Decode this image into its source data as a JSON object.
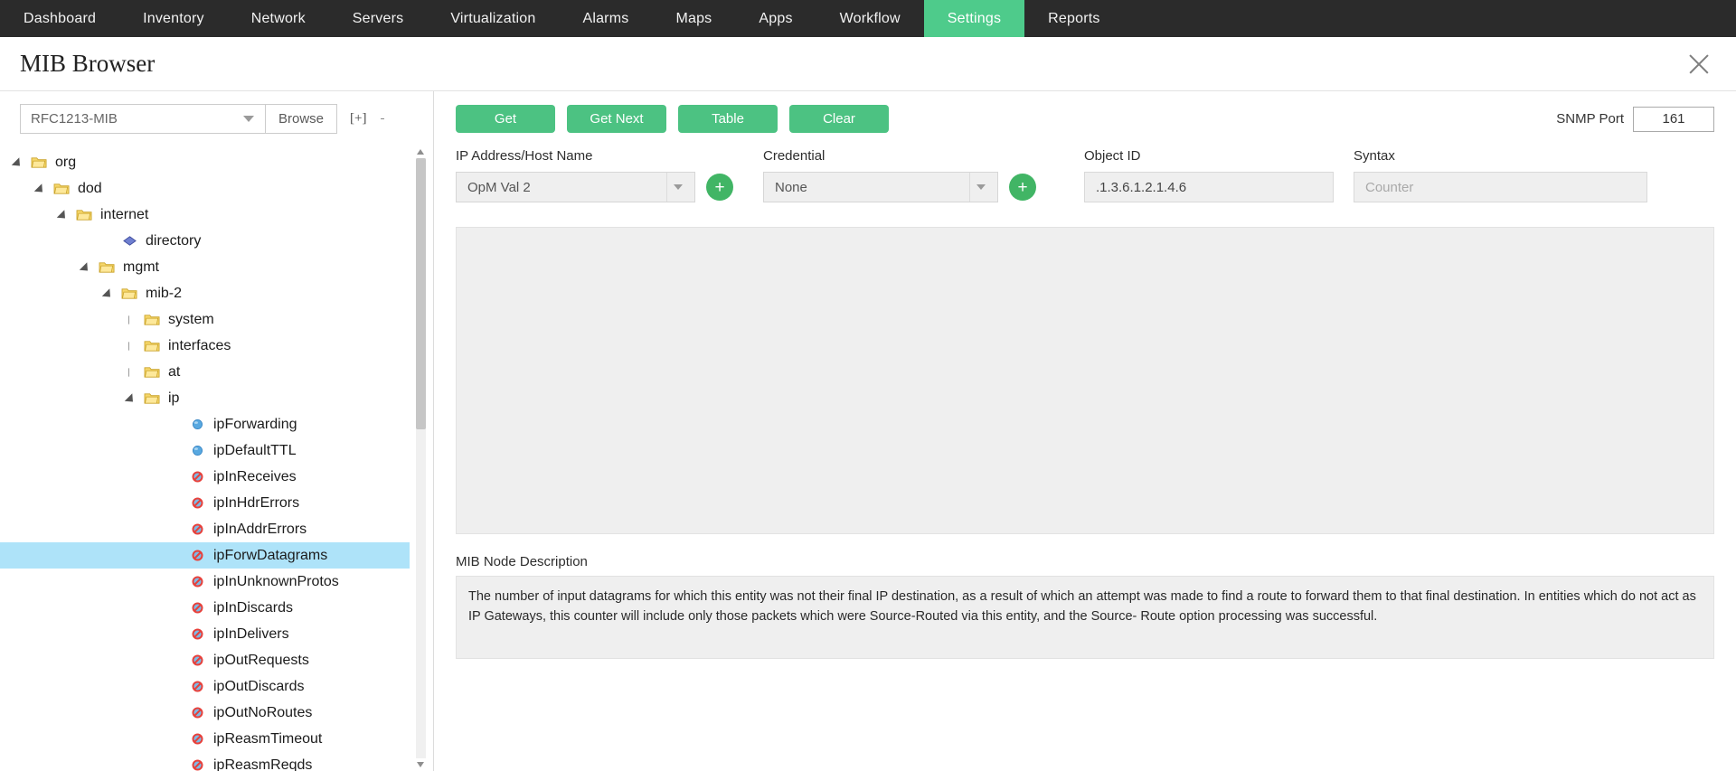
{
  "nav": {
    "items": [
      {
        "label": "Dashboard",
        "active": false
      },
      {
        "label": "Inventory",
        "active": false
      },
      {
        "label": "Network",
        "active": false
      },
      {
        "label": "Servers",
        "active": false
      },
      {
        "label": "Virtualization",
        "active": false
      },
      {
        "label": "Alarms",
        "active": false
      },
      {
        "label": "Maps",
        "active": false
      },
      {
        "label": "Apps",
        "active": false
      },
      {
        "label": "Workflow",
        "active": false
      },
      {
        "label": "Settings",
        "active": true
      },
      {
        "label": "Reports",
        "active": false
      }
    ],
    "active_color": "#4ecb8b",
    "bg_color": "#2b2b2b"
  },
  "header": {
    "title": "MIB Browser",
    "close_icon": "close-icon"
  },
  "mib_selector": {
    "selected": "RFC1213-MIB",
    "browse_label": "Browse",
    "expand_all_label": "[+]",
    "collapse_all_label": "-"
  },
  "tree": {
    "nodes": [
      {
        "label": "org",
        "depth": 0,
        "icon": "folder-icon",
        "expander": "open",
        "selected": false
      },
      {
        "label": "dod",
        "depth": 1,
        "icon": "folder-icon",
        "expander": "open",
        "selected": false
      },
      {
        "label": "internet",
        "depth": 2,
        "icon": "folder-icon",
        "expander": "open",
        "selected": false
      },
      {
        "label": "directory",
        "depth": 4,
        "icon": "diamond-icon",
        "expander": "none",
        "selected": false
      },
      {
        "label": "mgmt",
        "depth": 3,
        "icon": "folder-icon",
        "expander": "open",
        "selected": false
      },
      {
        "label": "mib-2",
        "depth": 4,
        "icon": "folder-icon",
        "expander": "open",
        "selected": false
      },
      {
        "label": "system",
        "depth": 5,
        "icon": "folder-icon",
        "expander": "closed",
        "selected": false
      },
      {
        "label": "interfaces",
        "depth": 5,
        "icon": "folder-icon",
        "expander": "closed",
        "selected": false
      },
      {
        "label": "at",
        "depth": 5,
        "icon": "folder-icon",
        "expander": "closed",
        "selected": false
      },
      {
        "label": "ip",
        "depth": 5,
        "icon": "folder-icon",
        "expander": "open",
        "selected": false
      },
      {
        "label": "ipForwarding",
        "depth": 7,
        "icon": "sphere-icon",
        "expander": "none",
        "selected": false
      },
      {
        "label": "ipDefaultTTL",
        "depth": 7,
        "icon": "sphere-icon",
        "expander": "none",
        "selected": false
      },
      {
        "label": "ipInReceives",
        "depth": 7,
        "icon": "readonly-icon",
        "expander": "none",
        "selected": false
      },
      {
        "label": "ipInHdrErrors",
        "depth": 7,
        "icon": "readonly-icon",
        "expander": "none",
        "selected": false
      },
      {
        "label": "ipInAddrErrors",
        "depth": 7,
        "icon": "readonly-icon",
        "expander": "none",
        "selected": false
      },
      {
        "label": "ipForwDatagrams",
        "depth": 7,
        "icon": "readonly-icon",
        "expander": "none",
        "selected": true
      },
      {
        "label": "ipInUnknownProtos",
        "depth": 7,
        "icon": "readonly-icon",
        "expander": "none",
        "selected": false
      },
      {
        "label": "ipInDiscards",
        "depth": 7,
        "icon": "readonly-icon",
        "expander": "none",
        "selected": false
      },
      {
        "label": "ipInDelivers",
        "depth": 7,
        "icon": "readonly-icon",
        "expander": "none",
        "selected": false
      },
      {
        "label": "ipOutRequests",
        "depth": 7,
        "icon": "readonly-icon",
        "expander": "none",
        "selected": false
      },
      {
        "label": "ipOutDiscards",
        "depth": 7,
        "icon": "readonly-icon",
        "expander": "none",
        "selected": false
      },
      {
        "label": "ipOutNoRoutes",
        "depth": 7,
        "icon": "readonly-icon",
        "expander": "none",
        "selected": false
      },
      {
        "label": "ipReasmTimeout",
        "depth": 7,
        "icon": "readonly-icon",
        "expander": "none",
        "selected": false
      },
      {
        "label": "ipReasmReqds",
        "depth": 7,
        "icon": "readonly-icon",
        "expander": "none",
        "selected": false
      }
    ],
    "selected_highlight_color": "#aee3f9"
  },
  "actions": {
    "get_label": "Get",
    "get_next_label": "Get Next",
    "table_label": "Table",
    "clear_label": "Clear",
    "button_color": "#4cc282"
  },
  "snmp_port": {
    "label": "SNMP Port",
    "value": "161"
  },
  "fields": {
    "ip_address": {
      "label": "IP Address/Host Name",
      "value": "OpM Val 2",
      "add_label": "+"
    },
    "credential": {
      "label": "Credential",
      "value": "None",
      "add_label": "+"
    },
    "object_id": {
      "label": "Object ID",
      "value": ".1.3.6.1.2.1.4.6"
    },
    "syntax": {
      "label": "Syntax",
      "value": "",
      "placeholder": "Counter"
    }
  },
  "description": {
    "label": "MIB Node Description",
    "text": "The number of input datagrams for which this entity was not their final IP destination, as a result of which an attempt was made to find a route to forward them to that final destination. In entities which do not act as IP Gateways, this counter will include only those packets which were Source-Routed via this entity, and the Source- Route option processing was successful."
  }
}
